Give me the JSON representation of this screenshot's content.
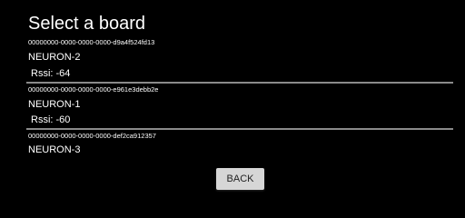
{
  "screen": {
    "title": "Select a board"
  },
  "boards": [
    {
      "id": "00000000-0000-0000-0000-d9a4f524fd13",
      "name": "NEURON-2",
      "rssi": "Rssi: -64"
    },
    {
      "id": "00000000-0000-0000-0000-e961e3debb2e",
      "name": "NEURON-1",
      "rssi": "Rssi: -60"
    },
    {
      "id": "00000000-0000-0000-0000-def2ca912357",
      "name": "NEURON-3"
    }
  ],
  "actions": {
    "back_label": "BACK"
  },
  "colors": {
    "background": "#000000",
    "text": "#ffffff",
    "divider": "#8a8a8a",
    "button_bg": "#d6d6d6",
    "button_text": "#222222"
  }
}
